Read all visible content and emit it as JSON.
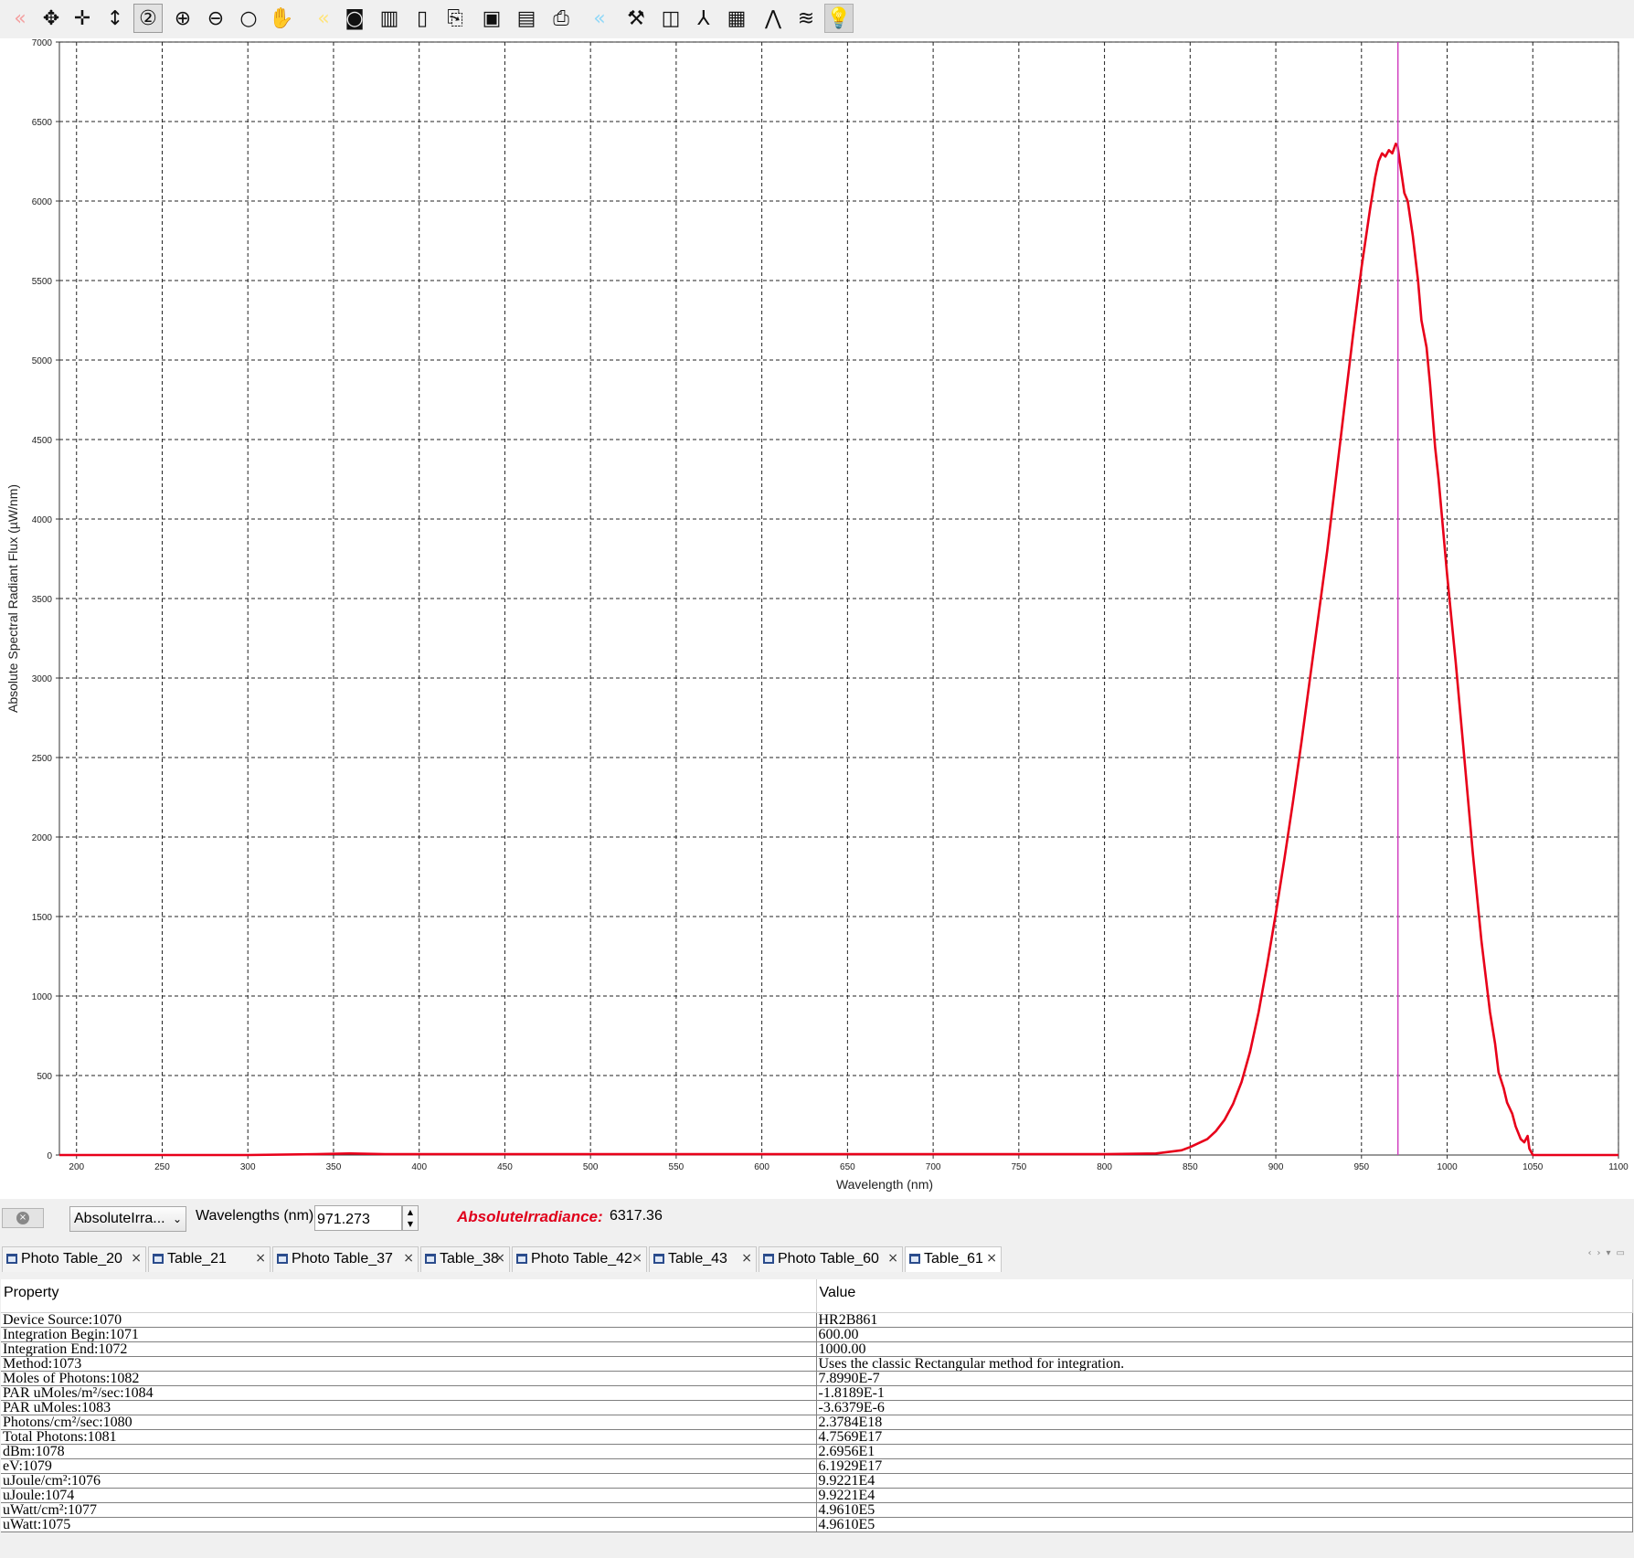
{
  "toolbar": {
    "buttons": [
      {
        "name": "back-icon",
        "glyph": "«",
        "state": "disabled-red"
      },
      {
        "name": "move-icon",
        "glyph": "✥",
        "state": "normal"
      },
      {
        "name": "crosshair-icon",
        "glyph": "✛",
        "state": "normal"
      },
      {
        "name": "vertical-resize-icon",
        "glyph": "↕",
        "state": "normal"
      },
      {
        "name": "zoom-level-icon",
        "glyph": "②",
        "state": "active"
      },
      {
        "name": "zoom-in-icon",
        "glyph": "⊕",
        "state": "normal"
      },
      {
        "name": "zoom-out-icon",
        "glyph": "⊖",
        "state": "normal"
      },
      {
        "name": "zoom-fit-icon",
        "glyph": "○",
        "state": "normal"
      },
      {
        "name": "pan-hand-icon",
        "glyph": "✋",
        "state": "normal"
      },
      {
        "name": "forward-icon",
        "glyph": "«",
        "state": "disabled"
      },
      {
        "name": "camera-icon",
        "glyph": "◙",
        "state": "normal"
      },
      {
        "name": "trash-icon",
        "glyph": "▥",
        "state": "normal"
      },
      {
        "name": "document-icon",
        "glyph": "▯",
        "state": "normal"
      },
      {
        "name": "export-icon",
        "glyph": "⎘",
        "state": "normal"
      },
      {
        "name": "save-icon",
        "glyph": "▣",
        "state": "normal"
      },
      {
        "name": "report-icon",
        "glyph": "▤",
        "state": "normal"
      },
      {
        "name": "printer-icon",
        "glyph": "⎙",
        "state": "normal"
      },
      {
        "name": "rewind-icon",
        "glyph": "«",
        "state": "disabled-blue"
      },
      {
        "name": "tools-icon",
        "glyph": "⚒",
        "state": "normal"
      },
      {
        "name": "spectrum-icon",
        "glyph": "◫",
        "state": "normal"
      },
      {
        "name": "peak-marker-icon",
        "glyph": "⅄",
        "state": "normal"
      },
      {
        "name": "table-icon",
        "glyph": "▦",
        "state": "normal"
      },
      {
        "name": "peaks-icon",
        "glyph": "⋀",
        "state": "normal"
      },
      {
        "name": "overlay-icon",
        "glyph": "≋",
        "state": "normal"
      },
      {
        "name": "lightbulb-icon",
        "glyph": "💡",
        "state": "bulb"
      }
    ]
  },
  "chart_data": {
    "type": "line",
    "title": "",
    "xlabel": "Wavelength (nm)",
    "ylabel": "Absolute Spectral Radiant Flux (µW/nm)",
    "xlim": [
      190,
      1100
    ],
    "ylim": [
      0,
      7000
    ],
    "xticks": [
      200,
      250,
      300,
      350,
      400,
      450,
      500,
      550,
      600,
      650,
      700,
      750,
      800,
      850,
      900,
      950,
      1000,
      1050,
      1100
    ],
    "yticks": [
      0,
      500,
      1000,
      1500,
      2000,
      2500,
      3000,
      3500,
      4000,
      4500,
      5000,
      5500,
      6000,
      6500,
      7000
    ],
    "grid": true,
    "cursor_x": 971.273,
    "colors": {
      "series": "#e8001a",
      "cursor": "#d040c0",
      "grid": "#222222"
    },
    "series": [
      {
        "x": [
          190,
          300,
          340,
          360,
          380,
          400,
          500,
          600,
          700,
          800,
          830,
          845,
          850,
          860,
          865,
          870,
          875,
          880,
          885,
          890,
          895,
          900,
          905,
          910,
          915,
          920,
          925,
          930,
          935,
          940,
          945,
          950,
          955,
          958,
          960,
          962,
          964,
          966,
          968,
          970,
          971,
          973,
          975,
          977,
          980,
          983,
          985,
          988,
          990,
          993,
          995,
          1000,
          1005,
          1010,
          1015,
          1020,
          1025,
          1028,
          1030,
          1033,
          1035,
          1038,
          1040,
          1043,
          1045,
          1047,
          1048,
          1050,
          1051,
          1060,
          1100
        ],
        "y": [
          0,
          0,
          5,
          10,
          5,
          5,
          5,
          5,
          5,
          5,
          10,
          30,
          50,
          100,
          150,
          220,
          320,
          460,
          650,
          900,
          1200,
          1520,
          1860,
          2220,
          2600,
          3000,
          3400,
          3800,
          4250,
          4700,
          5150,
          5580,
          5950,
          6150,
          6250,
          6300,
          6280,
          6320,
          6300,
          6360,
          6350,
          6200,
          6050,
          6000,
          5780,
          5500,
          5250,
          5080,
          4850,
          4450,
          4250,
          3650,
          3100,
          2500,
          1900,
          1350,
          900,
          700,
          520,
          420,
          330,
          260,
          180,
          100,
          80,
          120,
          40,
          0,
          0,
          0,
          0
        ]
      }
    ]
  },
  "controls": {
    "measure_select": "AbsoluteIrra...",
    "wavelength_label": "Wavelengths (nm)",
    "wavelength_value": "971.273",
    "irradiance_label": "AbsoluteIrradiance:",
    "irradiance_value": "6317.36"
  },
  "tabs": [
    {
      "label": "Photo Table_20",
      "selected": false
    },
    {
      "label": "Table_21",
      "selected": false
    },
    {
      "label": "Photo Table_37",
      "selected": false
    },
    {
      "label": "Table_38",
      "selected": false
    },
    {
      "label": "Photo Table_42",
      "selected": false
    },
    {
      "label": "Table_43",
      "selected": false
    },
    {
      "label": "Photo Table_60",
      "selected": false
    },
    {
      "label": "Table_61",
      "selected": true
    }
  ],
  "table": {
    "headers": [
      "Property",
      "Value"
    ],
    "rows": [
      [
        "Device Source:1070",
        "HR2B861"
      ],
      [
        "Integration Begin:1071",
        "600.00"
      ],
      [
        "Integration End:1072",
        "1000.00"
      ],
      [
        "Method:1073",
        "Uses the classic Rectangular method for integration."
      ],
      [
        "Moles of Photons:1082",
        "7.8990E-7"
      ],
      [
        "PAR uMoles/m²/sec:1084",
        "-1.8189E-1"
      ],
      [
        "PAR uMoles:1083",
        "-3.6379E-6"
      ],
      [
        "Photons/cm²/sec:1080",
        "2.3784E18"
      ],
      [
        "Total Photons:1081",
        "4.7569E17"
      ],
      [
        "dBm:1078",
        "2.6956E1"
      ],
      [
        "eV:1079",
        "6.1929E17"
      ],
      [
        "uJoule/cm²:1076",
        "9.9221E4"
      ],
      [
        "uJoule:1074",
        "9.9221E4"
      ],
      [
        "uWatt/cm²:1077",
        "4.9610E5"
      ],
      [
        "uWatt:1075",
        "4.9610E5"
      ]
    ]
  }
}
